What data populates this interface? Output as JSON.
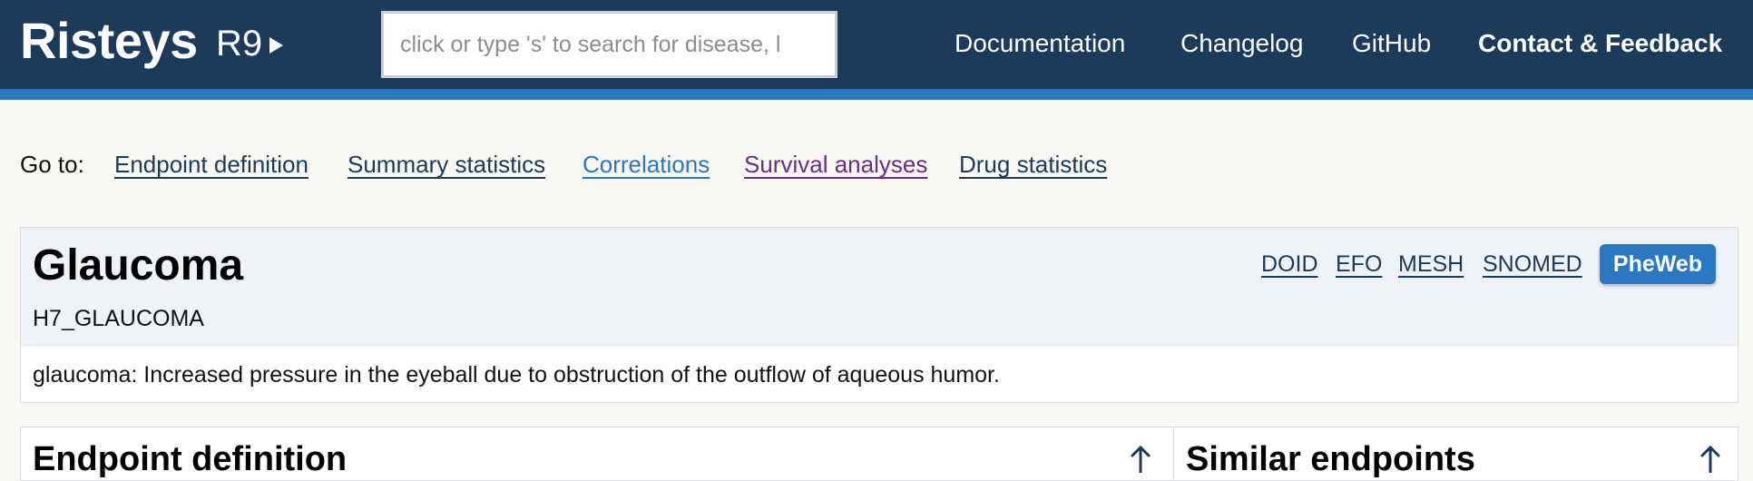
{
  "header": {
    "brand": "Risteys",
    "release": "R9",
    "search_placeholder": "click or type 's' to search for disease, l",
    "nav": [
      "Documentation",
      "Changelog",
      "GitHub",
      "Contact & Feedback"
    ]
  },
  "goto": {
    "label": "Go to:",
    "links": [
      "Endpoint definition",
      "Summary statistics",
      "Correlations",
      "Survival analyses",
      "Drug statistics"
    ]
  },
  "endpoint": {
    "title": "Glaucoma",
    "code": "H7_GLAUCOMA",
    "external_links": [
      "DOID",
      "EFO",
      "MESH",
      "SNOMED"
    ],
    "pheweb_label": "PheWeb",
    "description": "glaucoma: Increased pressure in the eyeball due to obstruction of the outflow of aqueous humor."
  },
  "panels": {
    "left_title": "Endpoint definition",
    "right_title": "Similar endpoints"
  },
  "colors": {
    "header_bg": "#1c3a5a",
    "accent_blue": "#2b78c2",
    "visited_purple": "#6b2c86",
    "page_bg": "#f9f8f4"
  },
  "icons": {
    "release_toggle": "triangle-right-icon",
    "scroll_up": "arrow-up-icon"
  }
}
